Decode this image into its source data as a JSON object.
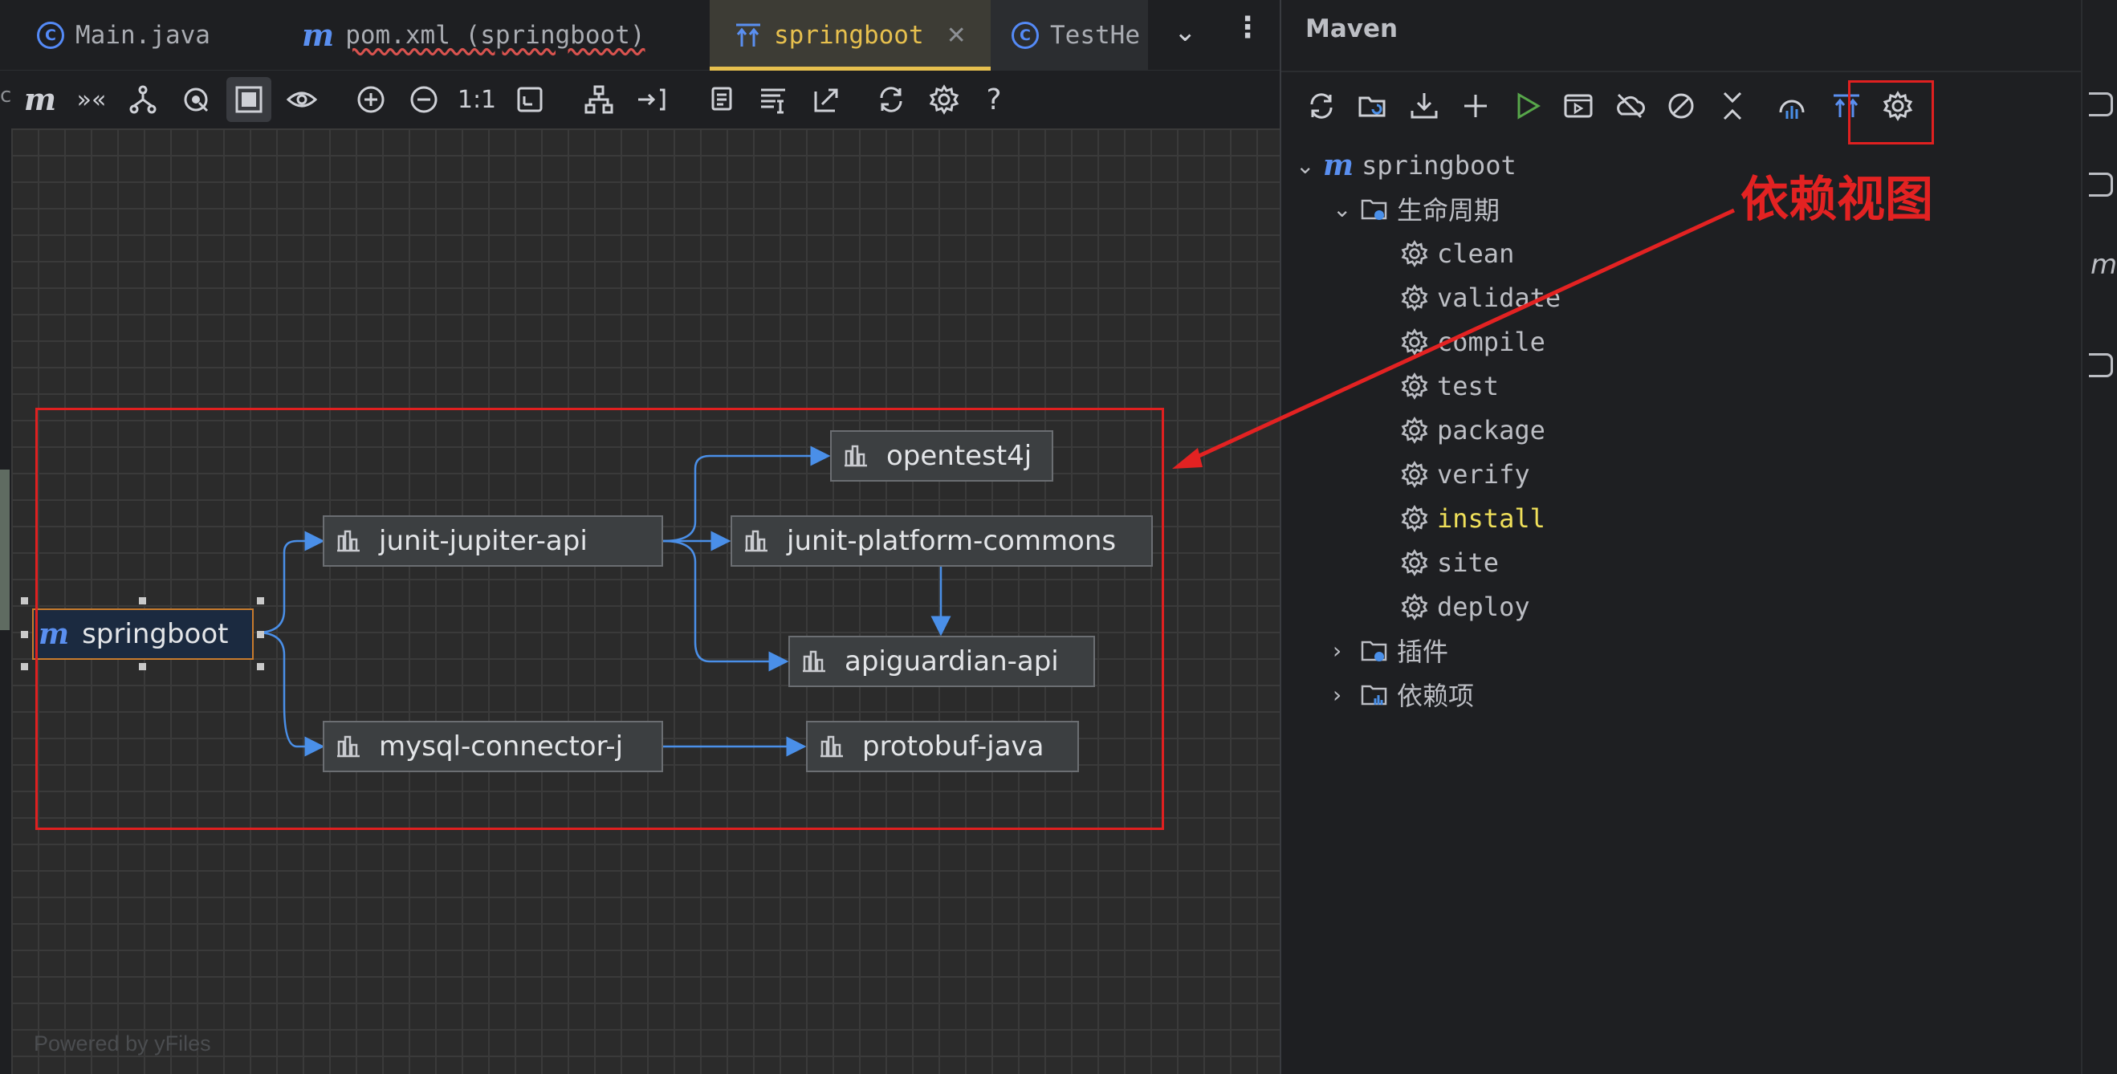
{
  "tabs": [
    {
      "label": "Main.java",
      "icon": "class-icon"
    },
    {
      "label": "pom.xml (springboot)",
      "icon": "maven-icon"
    },
    {
      "label": "springboot",
      "icon": "dependency-diagram-icon",
      "active": true
    },
    {
      "label": "TestHe",
      "icon": "class-icon"
    }
  ],
  "diagram": {
    "root": "springboot",
    "nodes": {
      "junit_jupiter_api": "junit-jupiter-api",
      "mysql_connector_j": "mysql-connector-j",
      "opentest4j": "opentest4j",
      "junit_platform_commons": "junit-platform-commons",
      "apiguardian_api": "apiguardian-api",
      "protobuf_java": "protobuf-java"
    },
    "toolbar_zoom_label": "1:1",
    "help_label": "?",
    "watermark": "Powered by yFiles"
  },
  "maven": {
    "title": "Maven",
    "project": "springboot",
    "lifecycle_label": "生命周期",
    "phases": [
      "clean",
      "validate",
      "compile",
      "test",
      "package",
      "verify",
      "install",
      "site",
      "deploy"
    ],
    "highlighted_phase": "install",
    "plugins_label": "插件",
    "dependencies_label": "依赖项"
  },
  "annotation": {
    "text": "依赖视图",
    "color": "#e32222"
  },
  "colors": {
    "accent_yellow": "#e7c04e",
    "edge_blue": "#4a8fe8",
    "run_green": "#57a64a",
    "maven_blue": "#5a8ff0"
  }
}
